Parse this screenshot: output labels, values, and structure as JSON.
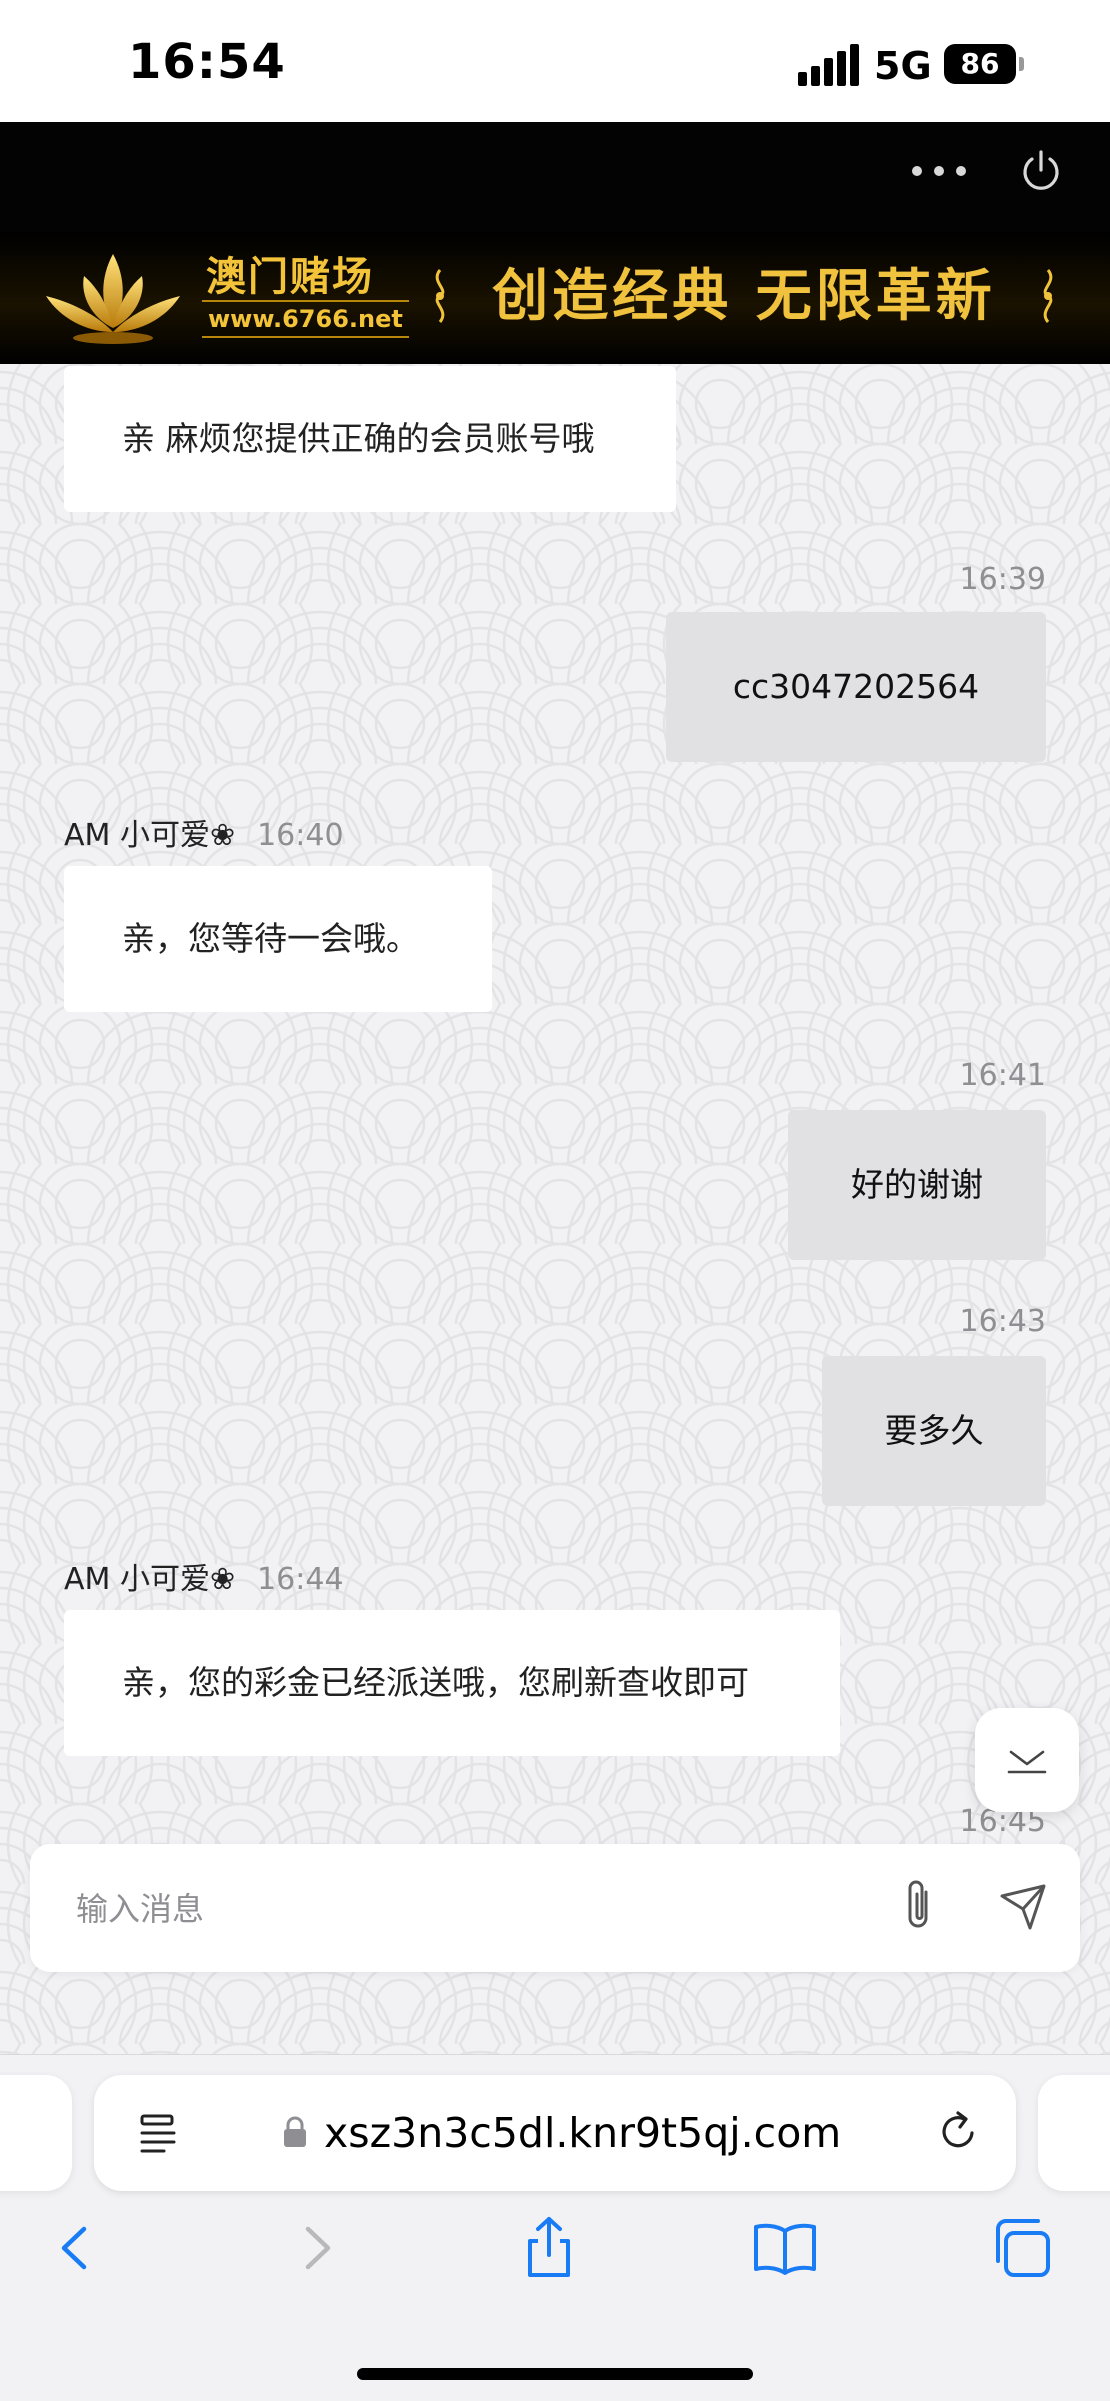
{
  "status_bar": {
    "time": "16:54",
    "network": "5G",
    "battery": "86"
  },
  "header": {
    "more_icon": "ellipsis-icon",
    "power_icon": "power-icon",
    "banner": {
      "brand_name": "澳门赌场",
      "brand_url": "www.6766.net",
      "slogan": "创造经典  无限革新"
    }
  },
  "chat": {
    "messages": [
      {
        "direction": "in",
        "text": "亲 麻烦您提供正确的会员账号哦"
      },
      {
        "direction": "out",
        "time": "16:39",
        "text": "cc3047202564"
      },
      {
        "direction": "in",
        "sender": "AM 小可爱❀",
        "time": "16:40",
        "text": "亲，您等待一会哦。"
      },
      {
        "direction": "out",
        "time": "16:41",
        "text": "好的谢谢"
      },
      {
        "direction": "out",
        "time": "16:43",
        "text": "要多久"
      },
      {
        "direction": "in",
        "sender": "AM 小可爱❀",
        "time": "16:44",
        "text": "亲，您的彩金已经派送哦，您刷新查收即可"
      },
      {
        "direction": "out",
        "time": "16:45"
      }
    ],
    "composer": {
      "placeholder": "输入消息"
    }
  },
  "browser": {
    "url": "xsz3n3c5dl.knr9t5qj.com",
    "toolbar": [
      "back-icon",
      "forward-icon",
      "share-icon",
      "bookmarks-icon",
      "tabs-icon"
    ]
  },
  "colors": {
    "header_bg": "#030303",
    "gold": "#f3c43a",
    "bubble_in": "#ffffff",
    "bubble_out": "#e1e1e3",
    "chat_bg": "#f2f2f4"
  }
}
